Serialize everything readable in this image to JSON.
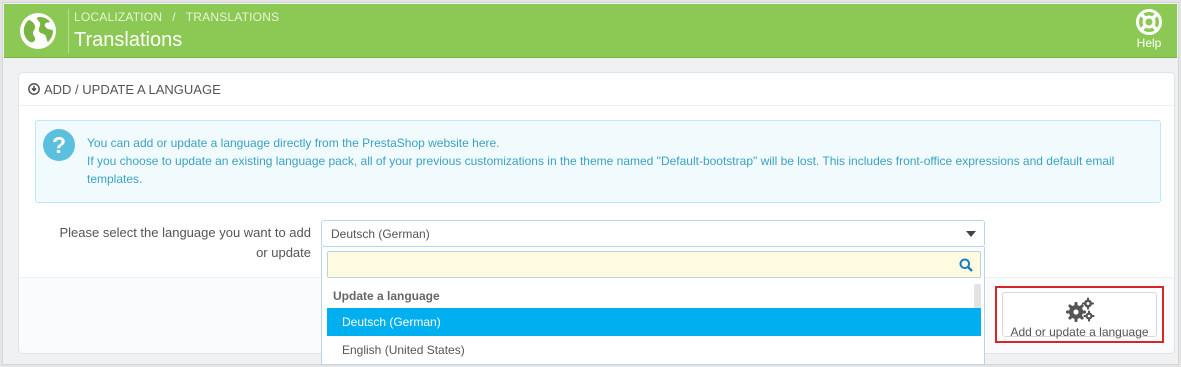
{
  "header": {
    "breadcrumb": [
      "LOCALIZATION",
      "TRANSLATIONS"
    ],
    "breadcrumb_separator": "/",
    "title": "Translations",
    "help_label": "Help",
    "logo_icon": "globe-icon",
    "accent_color": "#8bc954"
  },
  "panel": {
    "heading": "ADD / UPDATE A LANGUAGE",
    "heading_icon": "download-icon",
    "info": {
      "icon": "question-icon",
      "line1": "You can add or update a language directly from the PrestaShop website here.",
      "line2": "If you choose to update an existing language pack, all of your previous customizations in the theme named \"Default-bootstrap\" will be lost. This includes front-office expressions and default email templates."
    },
    "form": {
      "label": "Please select the language you want to add or update",
      "selected_value": "Deutsch (German)",
      "search_placeholder": "",
      "group_label": "Update a language",
      "options": [
        "Deutsch (German)",
        "English (United States)"
      ],
      "selected_option_color": "#00aff0"
    },
    "submit": {
      "label": "Add or update a language",
      "icon": "gears-icon",
      "highlight_color": "#d9242a"
    }
  }
}
